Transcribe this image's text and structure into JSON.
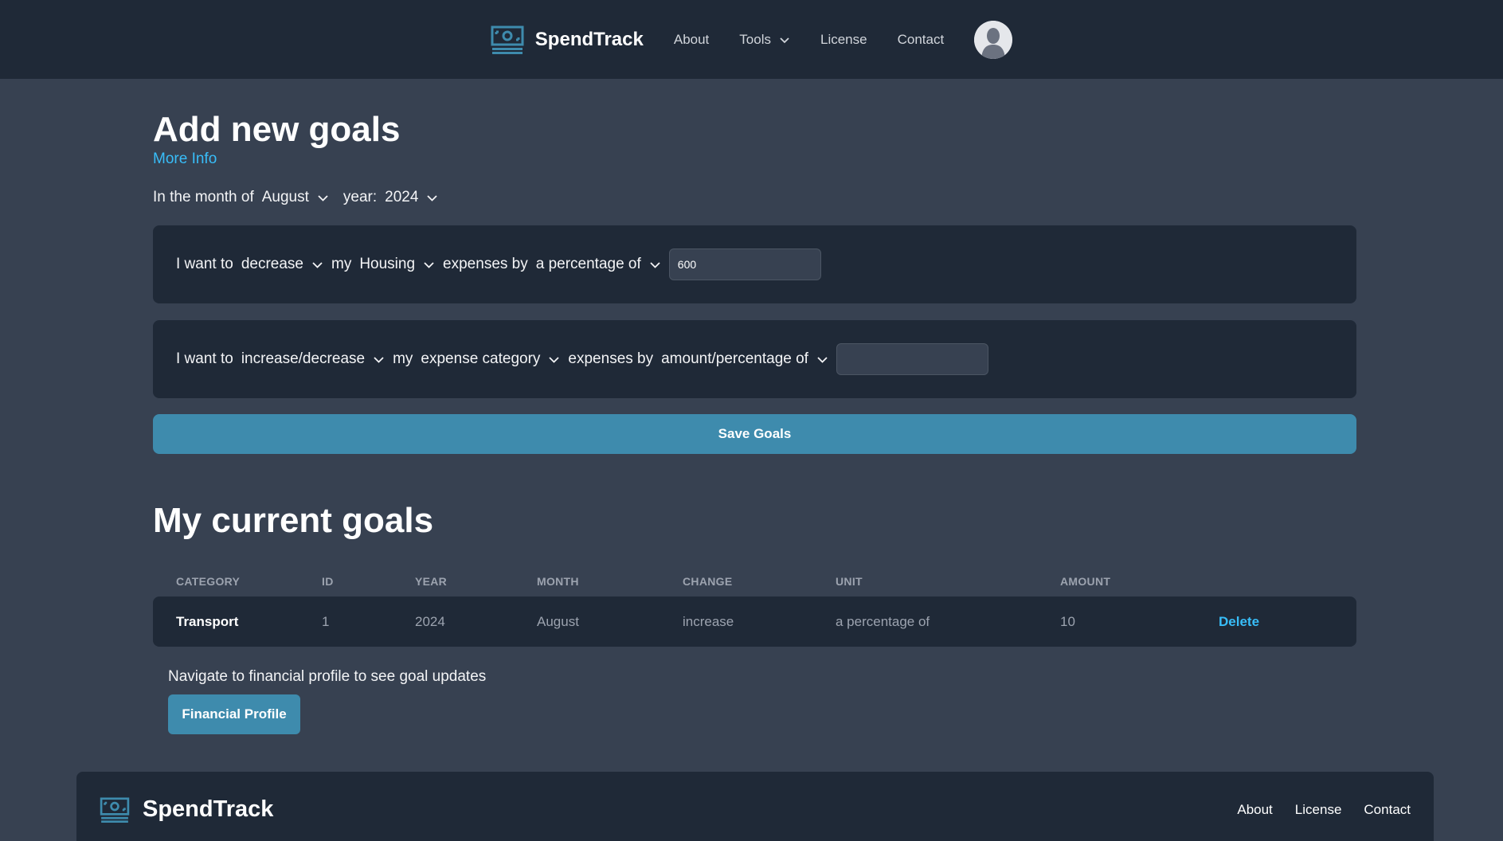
{
  "colors": {
    "page_bg": "#374151",
    "panel_bg": "#1f2937",
    "accent": "#3e8bad",
    "link": "#38bdf8"
  },
  "nav": {
    "brand": "SpendTrack",
    "logo_icon": "cash-icon",
    "links": {
      "about": "About",
      "tools": "Tools",
      "license": "License",
      "contact": "Contact"
    },
    "avatar_icon": "user-avatar-icon"
  },
  "add_goals": {
    "title": "Add new goals",
    "more_info": "More Info",
    "month_prefix": "In the month of",
    "month_value": "August",
    "year_label": "year:",
    "year_value": "2024",
    "goals": [
      {
        "prefix": "I want to",
        "direction": "decrease",
        "my": "my",
        "category": "Housing",
        "expenses_by": "expenses by",
        "unit": "a percentage of",
        "amount": "600",
        "placeholder": ""
      },
      {
        "prefix": "I want to",
        "direction": "increase/decrease",
        "my": "my",
        "category": "expense category",
        "expenses_by": "expenses by",
        "unit": "amount/percentage of",
        "amount": "",
        "placeholder": ""
      }
    ],
    "save_label": "Save Goals"
  },
  "current_goals": {
    "title": "My current goals",
    "columns": [
      "CATEGORY",
      "ID",
      "YEAR",
      "MONTH",
      "CHANGE",
      "UNIT",
      "AMOUNT"
    ],
    "rows": [
      {
        "category": "Transport",
        "id": "1",
        "year": "2024",
        "month": "August",
        "change": "increase",
        "unit": "a percentage of",
        "amount": "10",
        "action": "Delete"
      }
    ],
    "hint": "Navigate to financial profile to see goal updates",
    "profile_button": "Financial Profile"
  },
  "footer": {
    "brand": "SpendTrack",
    "links": {
      "about": "About",
      "license": "License",
      "contact": "Contact"
    }
  }
}
